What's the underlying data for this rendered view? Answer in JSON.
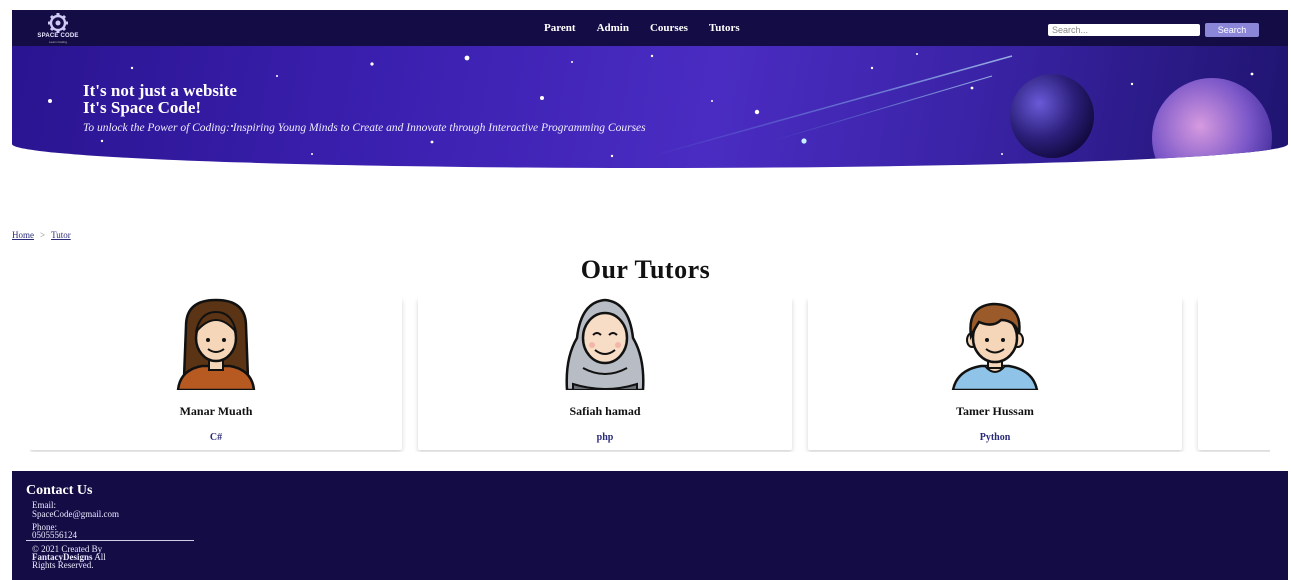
{
  "header": {
    "logo_text": "SPACE CODE",
    "logo_subtext": "Learn Coding",
    "nav": [
      "Parent",
      "Admin",
      "Courses",
      "Tutors"
    ],
    "search_placeholder": "Search...",
    "search_button": "Search"
  },
  "hero": {
    "title_line1": "It's not just a website",
    "title_line2": "It's Space Code!",
    "subtitle": "To unlock the Power of Coding: Inspiring Young Minds to Create and Innovate through Interactive Programming Courses"
  },
  "breadcrumb": {
    "home": "Home",
    "separator": ">",
    "current": "Tutor"
  },
  "page_title": "Our Tutors",
  "tutors": [
    {
      "name": "Manar Muath",
      "course": "C#",
      "avatar": "female-long-hair-avatar-icon"
    },
    {
      "name": "Safiah hamad",
      "course": "php",
      "avatar": "female-hijab-avatar-icon"
    },
    {
      "name": "Tamer Hussam",
      "course": "Python",
      "avatar": "male-avatar-icon"
    }
  ],
  "footer": {
    "heading": "Contact Us",
    "email_label": "Email:",
    "email": "SpaceCode@gmail.com",
    "phone_label": "Phone:",
    "phone": "0505556124",
    "copyright_prefix": "© 2021 Created By",
    "company": "FantacyDesigns",
    "copyright_suffix": "All",
    "rights": "Rights Reserved."
  },
  "colors": {
    "navbar": "#140d45",
    "footer": "#140d45",
    "search_button": "#8b86d8",
    "course_text": "#2a2a7a"
  }
}
